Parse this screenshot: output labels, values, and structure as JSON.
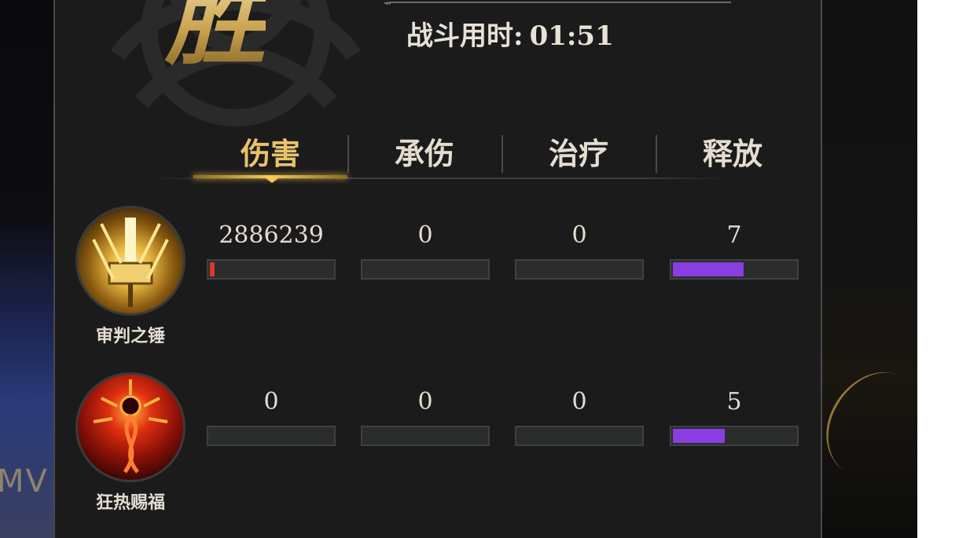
{
  "header": {
    "result_title": "胜",
    "battle_time_label": "战斗用时:",
    "battle_time_value": "01:51"
  },
  "tabs": [
    {
      "label": "伤害",
      "active": true
    },
    {
      "label": "承伤",
      "active": false
    },
    {
      "label": "治疗",
      "active": false
    },
    {
      "label": "释放",
      "active": false
    }
  ],
  "heroes": [
    {
      "name": "审判之锤",
      "icon": "hammer-icon",
      "damage": "2886239",
      "damage_taken": "0",
      "healing": "0",
      "casts": "7",
      "bar_fill": {
        "damage": 0.04,
        "damage_taken": 0,
        "healing": 0,
        "casts": 0.58
      }
    },
    {
      "name": "狂热赐福",
      "icon": "flame-sun-icon",
      "damage": "0",
      "damage_taken": "0",
      "healing": "0",
      "casts": "5",
      "bar_fill": {
        "damage": 0,
        "damage_taken": 0,
        "healing": 0,
        "casts": 0.42
      }
    }
  ],
  "colors": {
    "damage_bar": "#d83a2a",
    "casts_bar": "#8a3de0",
    "accent_gold": "#e8c36a"
  }
}
